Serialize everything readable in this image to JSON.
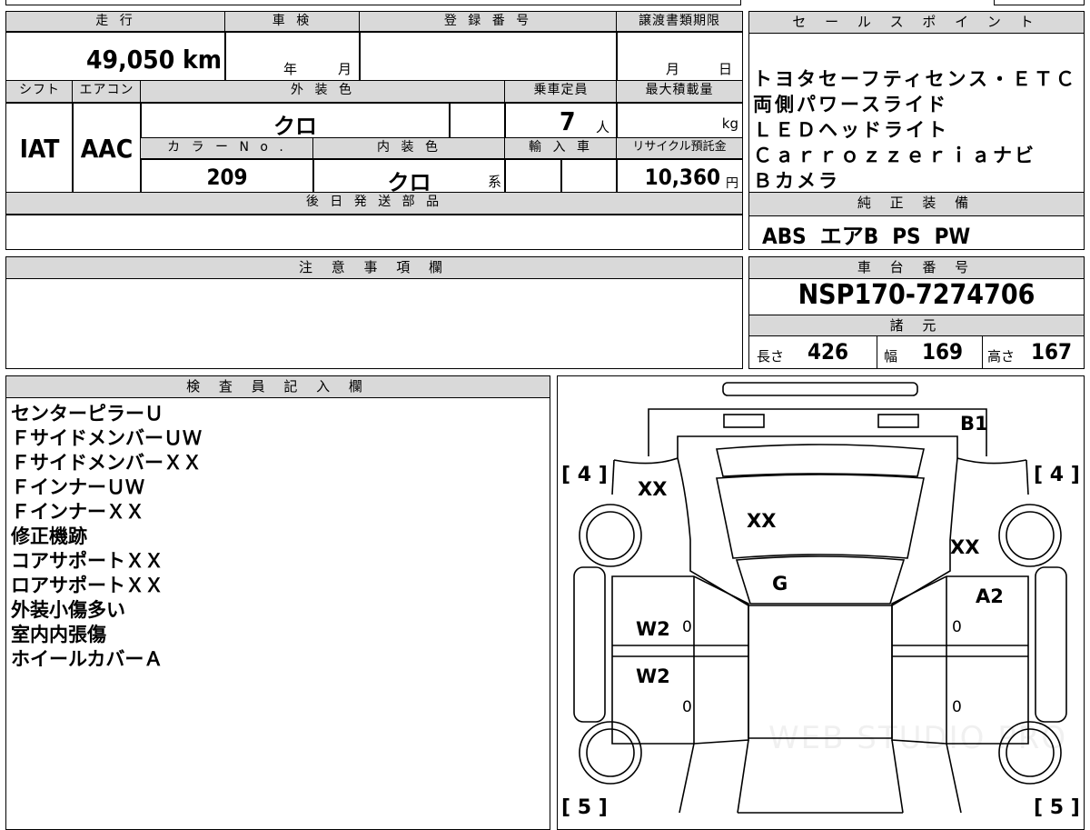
{
  "labels": {
    "mileage": "走 行",
    "inspection": "車 検",
    "registration": "登 録 番 号",
    "transfer_deadline": "譲渡書類期限",
    "sales_points": "セ ー ル ス ポ イ ン ト",
    "shift": "シフト",
    "aircon": "エアコン",
    "exterior_color": "外 装 色",
    "capacity": "乗車定員",
    "max_load": "最大積載量",
    "color_no": "カ ラ ー N o .",
    "interior_color": "内 装 色",
    "import": "輸 入 車",
    "recycle": "リサイクル預託金",
    "later_parts": "後 日 発 送 部 品",
    "genuine_equipment": "純 正 装 備",
    "notes": "注 意 事 項 欄",
    "chassis_no": "車 台 番 号",
    "specs": "諸 元",
    "inspector": "検 査 員 記 入 欄"
  },
  "values": {
    "mileage": "49,050 km",
    "year_unit": "年",
    "month_unit": "月",
    "transfer_month": "月",
    "transfer_day": "日",
    "shift": "IAT",
    "aircon": "AAC",
    "exterior_color": "クロ",
    "capacity": "7",
    "capacity_unit": "人",
    "max_load_unit": "kg",
    "color_no": "209",
    "interior_color": "クロ",
    "interior_suffix": "系",
    "recycle": "10,360",
    "recycle_unit": "円",
    "genuine_equipment": "ABS  エアB  PS  PW",
    "chassis_no": "NSP170-7274706",
    "length_label": "長さ",
    "length": "426",
    "width_label": "幅",
    "width": "169",
    "height_label": "高さ",
    "height": "167"
  },
  "sales_points": [
    "トヨタセーフティセンス・ＥＴＣ",
    "両側パワースライド",
    "ＬＥＤヘッドライト",
    "Ｃａｒｒｏｚｚｅｒｉａナビ",
    "Ｂカメラ"
  ],
  "inspector_notes": [
    "センターピラーＵ",
    "ＦサイドメンバーＵＷ",
    "ＦサイドメンバーＸＸ",
    "ＦインナーＵＷ",
    "ＦインナーＸＸ",
    "修正機跡",
    "コアサポートＸＸ",
    "ロアサポートＸＸ",
    "外装小傷多い",
    "室内内張傷",
    "ホイールカバーＡ"
  ],
  "diagram": {
    "tire_fl": "4",
    "tire_fr": "4",
    "tire_rl": "5",
    "tire_rr": "5",
    "rear_bumper": "B1",
    "left_front_fender": "XX",
    "hood": "XX",
    "right_front_fender": "XX",
    "windshield": "G",
    "right_front_door": "A2",
    "left_front_door": "W2",
    "left_rear_door": "W2",
    "door_zero_1": "0",
    "door_zero_2": "0",
    "door_zero_3": "0",
    "door_zero_4": "0",
    "watermark": "WEB STUDIO PRO"
  }
}
